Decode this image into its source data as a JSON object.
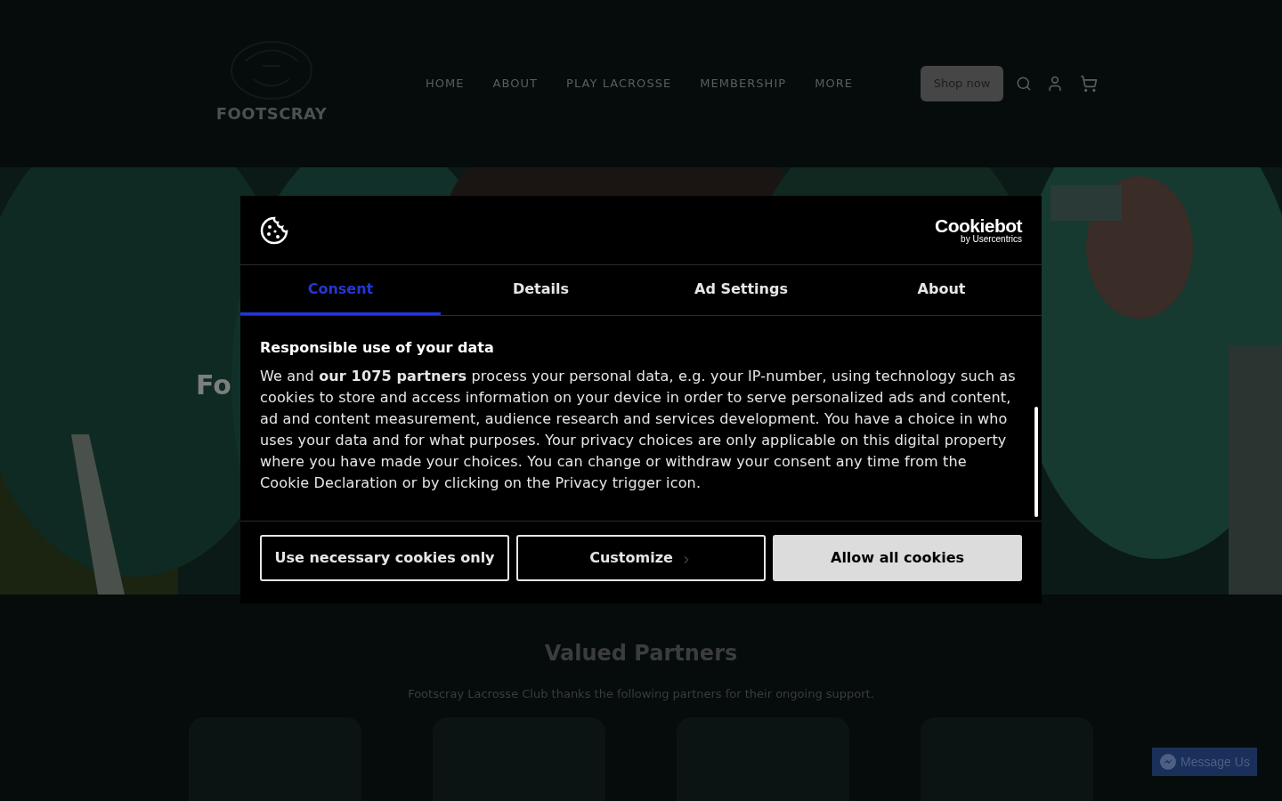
{
  "header": {
    "logo_text": "FOOTSCRAY",
    "nav": [
      {
        "label": "HOME"
      },
      {
        "label": "ABOUT"
      },
      {
        "label": "PLAY LACROSSE"
      },
      {
        "label": "MEMBERSHIP"
      },
      {
        "label": "MORE"
      }
    ],
    "shop_button": "Shop now"
  },
  "hero": {
    "kind": "picture",
    "heading": "Fo"
  },
  "cookie_dialog": {
    "brand": "Cookiebot",
    "brand_sub": "by Usercentrics",
    "tabs": [
      {
        "label": "Consent",
        "selected": true
      },
      {
        "label": "Details",
        "selected": false
      },
      {
        "label": "Ad Settings",
        "selected": false
      },
      {
        "label": "About",
        "selected": false
      }
    ],
    "heading": "Responsible use of your data",
    "body": "We and **our 1075 partners** process your personal data, e.g. your IP-number, using technology such as cookies to store and access information on your device in order to serve personalized ads and content, ad and content measurement, audience research and services development. You have a choice in who uses your data and for what purposes. Your privacy choices are only applicable on this digital property where you have made your choices. You can change or withdraw your consent any time from the Cookie Declaration or by clicking on the Privacy trigger icon.",
    "buttons": [
      {
        "label": "Use necessary cookies only",
        "kind": "outline"
      },
      {
        "label": "Customize",
        "kind": "chevron"
      },
      {
        "label": "Allow all cookies",
        "kind": "filled"
      }
    ]
  },
  "partners": {
    "title": "Valued Partners",
    "subtitle": "Footscray Lacrosse Club thanks the following partners for their ongoing support."
  },
  "messenger": {
    "label": "Message Us"
  }
}
